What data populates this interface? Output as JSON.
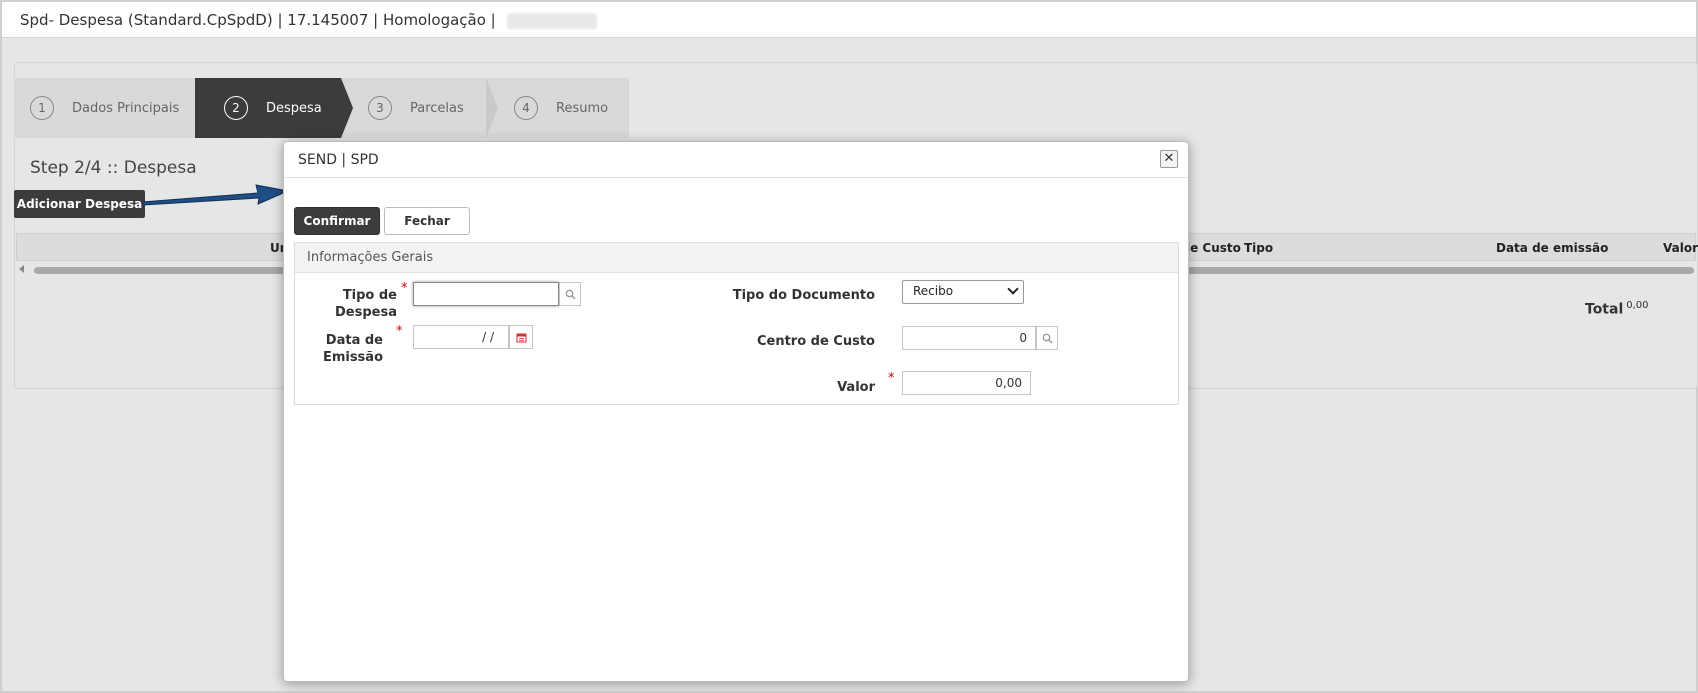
{
  "window": {
    "title": "Spd- Despesa (Standard.CpSpdD) | 17.145007 | Homologação |"
  },
  "wizard": {
    "steps": [
      {
        "number": "1",
        "label": "Dados Principais",
        "active": false
      },
      {
        "number": "2",
        "label": "Despesa",
        "active": true
      },
      {
        "number": "3",
        "label": "Parcelas",
        "active": false
      },
      {
        "number": "4",
        "label": "Resumo",
        "active": false
      }
    ]
  },
  "page": {
    "step_title": "Step 2/4 :: Despesa",
    "add_button": "Adicionar Despesa"
  },
  "table": {
    "columns": [
      "Un",
      "le Custo",
      "Tipo",
      "Data de emissão",
      "Valor"
    ]
  },
  "totals": {
    "label": "Total",
    "value": "0,00"
  },
  "modal": {
    "title": "SEND | SPD",
    "close_icon": "close-icon",
    "confirm_button": "Confirmar",
    "close_button": "Fechar",
    "section_title": "Informações Gerais",
    "fields": {
      "tipo_despesa_label": "Tipo de Despesa",
      "tipo_despesa_value": "",
      "data_emissao_label": "Data de Emissão",
      "data_emissao_value": "/ /",
      "tipo_documento_label": "Tipo do Documento",
      "tipo_documento_value": "Recibo",
      "centro_custo_label": "Centro de Custo",
      "centro_custo_value": "0",
      "valor_label": "Valor",
      "valor_value": "0,00"
    },
    "required_mark": "*"
  },
  "colors": {
    "dark": "#3c3c3c",
    "required": "#dd0000",
    "arrow": "#1f4e86"
  }
}
